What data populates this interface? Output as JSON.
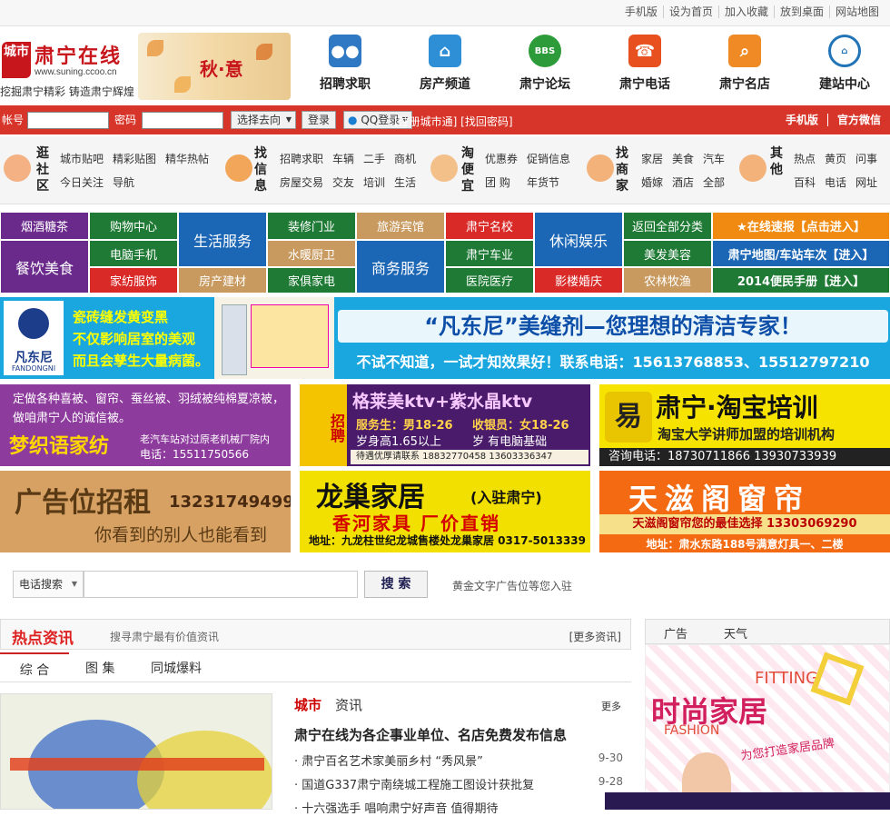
{
  "topbar": {
    "links": [
      "手机版",
      "设为首页",
      "加入收藏",
      "放到桌面",
      "网站地图"
    ]
  },
  "header": {
    "logo_badge": "城市",
    "site_name": "肃宁在线",
    "site_url": "www.suning.ccoo.cn",
    "slogan": "挖掘肃宁精彩 铸造肃宁辉煌",
    "banner_text": "秋·意",
    "nav": [
      {
        "label": "招聘求职",
        "icon": "people-icon",
        "color": "#2f78c4"
      },
      {
        "label": "房产频道",
        "icon": "house-icon",
        "color": "#2e8fd6"
      },
      {
        "label": "肃宁论坛",
        "icon": "bbs-icon",
        "color": "#2e9b3a"
      },
      {
        "label": "肃宁电话",
        "icon": "phone-icon",
        "color": "#e8511f"
      },
      {
        "label": "肃宁名店",
        "icon": "search-icon",
        "color": "#f08a24"
      },
      {
        "label": "建站中心",
        "icon": "build-icon",
        "color": "#2274b8"
      }
    ]
  },
  "login": {
    "user_label": "帐号",
    "pwd_label": "密码",
    "go_select": "选择去向",
    "login_btn": "登录",
    "qq_btn": "QQ登录",
    "links": "[注册城市通] [找回密码]",
    "right": [
      "手机版",
      "官方微信"
    ]
  },
  "categories": [
    {
      "title": "逛社区",
      "links": [
        [
          "城市贴吧",
          "精彩贴图",
          "精华热帖"
        ],
        [
          "今日关注",
          "导航"
        ]
      ]
    },
    {
      "title": "找信息",
      "links": [
        [
          "招聘求职",
          "车辆",
          "二手",
          "商机"
        ],
        [
          "房屋交易",
          "交友",
          "培训",
          "生活"
        ]
      ]
    },
    {
      "title": "淘便宜",
      "links": [
        [
          "优惠券",
          "促销信息"
        ],
        [
          "团 购",
          "年货节"
        ]
      ]
    },
    {
      "title": "找商家",
      "links": [
        [
          "家居",
          "美食",
          "汽车"
        ],
        [
          "婚嫁",
          "酒店",
          "全部"
        ]
      ]
    },
    {
      "title": "其他",
      "links": [
        [
          "热点",
          "黄页",
          "问事"
        ],
        [
          "百科",
          "电话",
          "网址"
        ]
      ]
    }
  ],
  "grid": {
    "c1": [
      "烟酒糖茶",
      "餐饮美食"
    ],
    "c2": [
      "购物中心",
      "电脑手机",
      "家纺服饰"
    ],
    "c3": "生活服务",
    "c4": [
      "装修门业",
      "水暖厨卫",
      "家俱家电"
    ],
    "c5a": "旅游宾馆",
    "c5b": "房产建材",
    "c6": "商务服务",
    "c7": [
      "肃宁名校",
      "肃宁车业",
      "医院医疗",
      "影楼婚庆"
    ],
    "c8": "休闲娱乐",
    "c9": [
      "返回全部分类",
      "美发美容",
      "农林牧渔"
    ],
    "c10": [
      "★在线速报【点击进入】",
      "肃宁地图/车站车次【进入】",
      "2014便民手册【进入】"
    ]
  },
  "ads": {
    "fdn": {
      "brand": "凡东尼",
      "brand_en": "FANDONGNI",
      "left": [
        "瓷砖缝发黄变黑",
        "不仅影响居室的美观",
        "而且会孳生大量病菌。"
      ],
      "headline": "“凡东尼”美缝剂—您理想的清洁专家！",
      "sub": "不试不知道，一试才知效果好！联系电话：15613768853、15512797210"
    },
    "mzy": {
      "text": "定做各种喜被、窗帘、蚕丝被、羽绒被纯棉夏凉被，做咱肃宁人的诚信被。",
      "brand": "梦织语家纺",
      "addr": "老汽车站对过原老机械厂院内",
      "tel": "电话：15511750566"
    },
    "ktv": {
      "side": "招聘",
      "title": "格莱美ktv+紫水晶ktv",
      "l1": "服务生：男18-26",
      "l2": "收银员：女18-26",
      "l3": "岁身高1.65以上",
      "l4": "岁 有电脑基础",
      "foot": "待遇优厚请联系 18832770458 13603336347"
    },
    "taobao": {
      "title": "肃宁·淘宝培训",
      "sub": "淘宝大学讲师加盟的培训机构",
      "tel": "咨询电话：18730711866 13930733939"
    },
    "rent": {
      "title": "广告位招租",
      "tel": "13231749499",
      "sub": "你看到的别人也能看到"
    },
    "lc": {
      "title": "龙巢家居",
      "tag": "(入驻肃宁)",
      "sub": "香河家具 厂价直销",
      "addr": "地址：九龙柱世纪龙城售楼处龙巢家居 0317-5013339"
    },
    "tz": {
      "title": "天滋阁窗帘",
      "sub": "天滋阁窗帘您的最佳选择 13303069290",
      "addr": "地址：肃水东路188号满意灯具一、二楼"
    }
  },
  "search": {
    "select": "电话搜索",
    "button": "搜 索",
    "tip": "黄金文字广告位等您入驻"
  },
  "news": {
    "title": "热点资讯",
    "subtitle": "搜寻肃宁最有价值资讯",
    "more": "[更多资讯]",
    "tabs": [
      "综 合",
      "图 集",
      "同城爆料"
    ],
    "city_red": "城市",
    "city_black": "资讯",
    "city_more": "更多",
    "lead": "肃宁在线为各企事业单位、名店免费发布信息",
    "items": [
      {
        "title": "· 肃宁百名艺术家美丽乡村 “秀风景”",
        "date": "9-30"
      },
      {
        "title": "· 国道G337肃宁南绕城工程施工图设计获批复",
        "date": "9-28"
      },
      {
        "title": "· 十六强选手 唱响肃宁好声音 值得期待",
        "date": ""
      }
    ]
  },
  "sidebar": {
    "tabs": [
      "广告",
      "天气"
    ],
    "ad_big": "时尚家居",
    "ad_en": "FITTING",
    "ad_en2": "FASHION",
    "ad_sub": "为您打造家居品牌"
  }
}
